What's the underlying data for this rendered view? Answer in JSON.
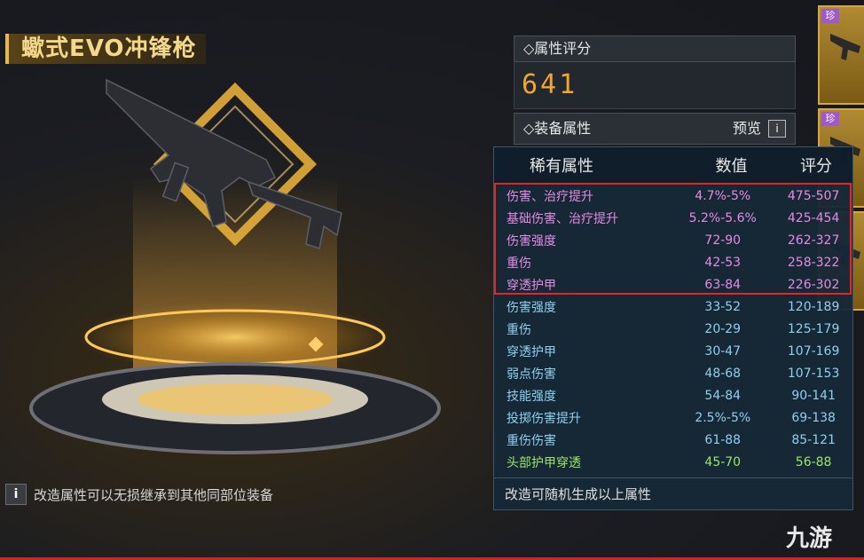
{
  "weapon": {
    "title": "蠍式EVO冲锋枪"
  },
  "tip": {
    "icon": "i",
    "text": "改造属性可以无损继承到其他同部位装备"
  },
  "score_panel": {
    "score_label": "◇属性评分",
    "score": "641",
    "equip_label": "◇装备属性",
    "preview_label": "预览",
    "preview_icon": "i"
  },
  "side_cards": [
    {
      "badge": "珍"
    },
    {
      "badge": "珍"
    },
    {
      "badge": ""
    }
  ],
  "popup": {
    "headers": {
      "name": "稀有属性",
      "value": "数值",
      "score": "评分"
    },
    "rows": [
      {
        "name": "伤害、治疗提升",
        "value": "4.7%-5%",
        "score": "475-507",
        "kind": "rare"
      },
      {
        "name": "基础伤害、治疗提升",
        "value": "5.2%-5.6%",
        "score": "425-454",
        "kind": "rare"
      },
      {
        "name": "伤害强度",
        "value": "72-90",
        "score": "262-327",
        "kind": "rare"
      },
      {
        "name": "重伤",
        "value": "42-53",
        "score": "258-322",
        "kind": "rare"
      },
      {
        "name": "穿透护甲",
        "value": "63-84",
        "score": "226-302",
        "kind": "rare"
      },
      {
        "name": "伤害强度",
        "value": "33-52",
        "score": "120-189",
        "kind": "normal"
      },
      {
        "name": "重伤",
        "value": "20-29",
        "score": "125-179",
        "kind": "normal"
      },
      {
        "name": "穿透护甲",
        "value": "30-47",
        "score": "107-169",
        "kind": "normal"
      },
      {
        "name": "弱点伤害",
        "value": "48-68",
        "score": "107-153",
        "kind": "normal"
      },
      {
        "name": "技能强度",
        "value": "54-84",
        "score": "90-141",
        "kind": "normal"
      },
      {
        "name": "投掷伤害提升",
        "value": "2.5%-5%",
        "score": "69-138",
        "kind": "normal"
      },
      {
        "name": "重伤伤害",
        "value": "61-88",
        "score": "85-121",
        "kind": "normal"
      },
      {
        "name": "头部护甲穿透",
        "value": "45-70",
        "score": "56-88",
        "kind": "green"
      }
    ],
    "footer": "改造可随机生成以上属性"
  },
  "watermark": "九游",
  "colors": {
    "rare": "#e58be5",
    "normal": "#8ed0f0",
    "green": "#9ae86a",
    "score": "#f2a531",
    "highlight": "#e2262a"
  }
}
